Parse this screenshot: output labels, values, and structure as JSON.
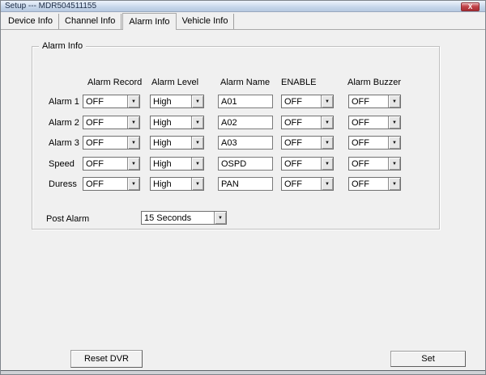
{
  "window": {
    "title": "Setup --- MDR504511155",
    "close_icon": "X"
  },
  "tabs": [
    {
      "label": "Device Info"
    },
    {
      "label": "Channel Info"
    },
    {
      "label": "Alarm Info",
      "active": true
    },
    {
      "label": "Vehicle Info"
    }
  ],
  "alarm": {
    "group_title": "Alarm Info",
    "headers": {
      "record": "Alarm Record",
      "level": "Alarm Level",
      "name": "Alarm Name",
      "enable": "ENABLE",
      "buzzer": "Alarm Buzzer"
    },
    "rows": [
      {
        "label": "Alarm 1",
        "record": "OFF",
        "level": "High",
        "name": "A01",
        "enable": "OFF",
        "buzzer": "OFF"
      },
      {
        "label": "Alarm 2",
        "record": "OFF",
        "level": "High",
        "name": "A02",
        "enable": "OFF",
        "buzzer": "OFF"
      },
      {
        "label": "Alarm 3",
        "record": "OFF",
        "level": "High",
        "name": "A03",
        "enable": "OFF",
        "buzzer": "OFF"
      },
      {
        "label": "Speed",
        "record": "OFF",
        "level": "High",
        "name": "OSPD",
        "enable": "OFF",
        "buzzer": "OFF"
      },
      {
        "label": "Duress",
        "record": "OFF",
        "level": "High",
        "name": "PAN",
        "enable": "OFF",
        "buzzer": "OFF"
      }
    ],
    "post_alarm": {
      "label": "Post Alarm",
      "value": "15 Seconds"
    }
  },
  "buttons": {
    "reset_dvr": "Reset DVR",
    "set": "Set"
  },
  "icons": {
    "dropdown_arrow": "▼"
  },
  "colors": {
    "body": "#f0f0f0",
    "titlebar_top": "#eef4fc",
    "titlebar_bottom": "#b6c9e0",
    "close_red": "#c04348"
  }
}
